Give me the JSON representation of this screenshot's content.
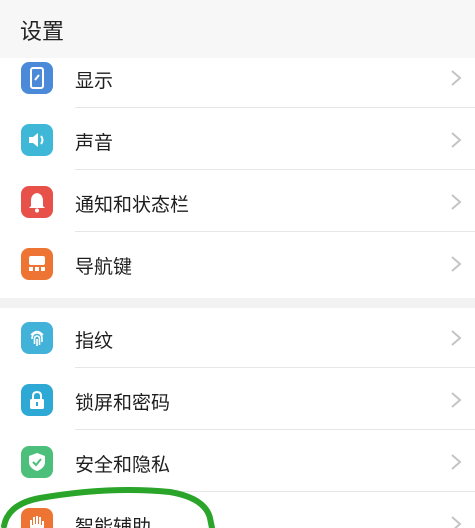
{
  "header": {
    "title": "设置"
  },
  "groups": [
    {
      "items": [
        {
          "label": "显示",
          "icon": "display-icon",
          "color": "#4a8ad8"
        },
        {
          "label": "声音",
          "icon": "sound-icon",
          "color": "#3fb8d8"
        },
        {
          "label": "通知和状态栏",
          "icon": "bell-icon",
          "color": "#e8514a"
        },
        {
          "label": "导航键",
          "icon": "navigation-key-icon",
          "color": "#ee7433"
        }
      ]
    },
    {
      "items": [
        {
          "label": "指纹",
          "icon": "fingerprint-icon",
          "color": "#42b2d8"
        },
        {
          "label": "锁屏和密码",
          "icon": "lock-icon",
          "color": "#2ea8d4"
        },
        {
          "label": "安全和隐私",
          "icon": "shield-icon",
          "color": "#4cc07a"
        },
        {
          "label": "智能辅助",
          "icon": "hand-icon",
          "color": "#ee7433"
        }
      ]
    }
  ],
  "colors": {
    "annotation_stroke": "#2aa52a"
  }
}
